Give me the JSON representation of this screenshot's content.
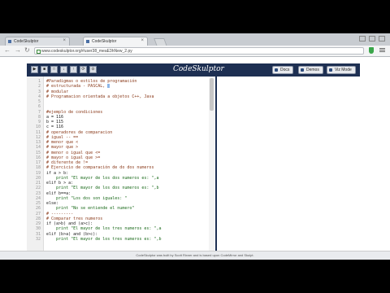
{
  "tabs": [
    {
      "label": "CodeSkulptor",
      "active": false
    },
    {
      "label": "CodeSkulptor",
      "active": true
    }
  ],
  "address": {
    "url": "www.codeskulptor.org/#user38_meaE3hNew_2.py"
  },
  "toolbar": {
    "brand": "CodeSkulptor",
    "buttons": [
      {
        "name": "run",
        "glyph": "▶"
      },
      {
        "name": "save",
        "glyph": "■"
      },
      {
        "name": "new",
        "glyph": "□"
      },
      {
        "name": "download",
        "glyph": "↓"
      },
      {
        "name": "load",
        "glyph": "↑"
      },
      {
        "name": "reset",
        "glyph": "⟳"
      },
      {
        "name": "viz",
        "glyph": "⊙"
      }
    ],
    "docs_label": "Docs",
    "demos_label": "Demos",
    "viz_mode_label": "Viz Mode"
  },
  "editor": {
    "lines": [
      {
        "n": "1",
        "text": "#Paradigmas o estilos de programación",
        "cls": "cm"
      },
      {
        "n": "2",
        "text": "# estructurada - PASCAL, ",
        "cls": "cm",
        "cursor": true
      },
      {
        "n": "3",
        "text": "# modular",
        "cls": "cm"
      },
      {
        "n": "4",
        "text": "# Programacion orientada a objetos C++, Java",
        "cls": "cm"
      },
      {
        "n": "5",
        "text": "",
        "cls": ""
      },
      {
        "n": "6",
        "text": "",
        "cls": ""
      },
      {
        "n": "7",
        "text": "#ejemplo de condiciones",
        "cls": "cm"
      },
      {
        "n": "8",
        "text": "a = 116",
        "cls": ""
      },
      {
        "n": "9",
        "text": "b = 115",
        "cls": ""
      },
      {
        "n": "10",
        "text": "c = 116",
        "cls": ""
      },
      {
        "n": "11",
        "text": "# operadores de comparacion",
        "cls": "cm"
      },
      {
        "n": "12",
        "text": "# igual -- ==",
        "cls": "cm"
      },
      {
        "n": "13",
        "text": "# menor que <",
        "cls": "cm"
      },
      {
        "n": "14",
        "text": "# mayor que >",
        "cls": "cm"
      },
      {
        "n": "15",
        "text": "# menor o igual que <=",
        "cls": "cm"
      },
      {
        "n": "16",
        "text": "# mayor o igual que >=",
        "cls": "cm"
      },
      {
        "n": "17",
        "text": "# diferente de !=",
        "cls": "cm"
      },
      {
        "n": "18",
        "text": "# Ejercicio de comparación de do dos numeros",
        "cls": "cm"
      },
      {
        "n": "19",
        "text": "if a > b:",
        "cls": ""
      },
      {
        "n": "20",
        "text": "    print \"El mayor de los dos numeros es: \",a",
        "cls": "st"
      },
      {
        "n": "21",
        "text": "elif b > a:",
        "cls": ""
      },
      {
        "n": "22",
        "text": "    print \"El mayor de los dos numeros es: \",b",
        "cls": "st"
      },
      {
        "n": "23",
        "text": "elif b==a:",
        "cls": ""
      },
      {
        "n": "24",
        "text": "    print \"Los dos son iguales: \"",
        "cls": "st"
      },
      {
        "n": "25",
        "text": "else:",
        "cls": ""
      },
      {
        "n": "26",
        "text": "    print \"No se entiende el numero\"",
        "cls": "st"
      },
      {
        "n": "27",
        "text": "# ---------",
        "cls": "cm"
      },
      {
        "n": "28",
        "text": "# Comparar tres numeros",
        "cls": "cm"
      },
      {
        "n": "29",
        "text": "if (a>b) and (a>c):",
        "cls": ""
      },
      {
        "n": "30",
        "text": "    print \"El mayor de los tres numeros es: \",a",
        "cls": "st"
      },
      {
        "n": "31",
        "text": "elif (b>a) and (b>c):",
        "cls": ""
      },
      {
        "n": "32",
        "text": "    print \"El mayor de los tres numeros es: \",b",
        "cls": "st"
      }
    ]
  },
  "footer": {
    "text": "CodeSkulptor was built by Scott Rixner and is based upon CodeMirror and Skulpt."
  }
}
